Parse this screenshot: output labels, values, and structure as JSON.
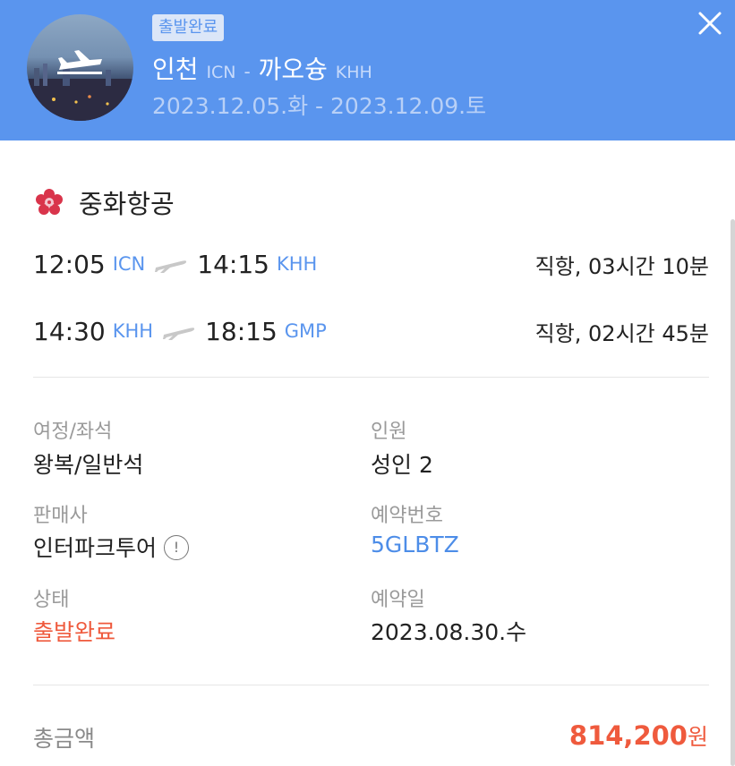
{
  "header": {
    "status_badge": "출발완료",
    "origin_city": "인천",
    "origin_code": "ICN",
    "separator": "-",
    "destination_city": "까오슝",
    "destination_code": "KHH",
    "dates": "2023.12.05.화 - 2023.12.09.토",
    "close_icon": "close-icon",
    "avatar_icon": "airplane-takeoff-icon"
  },
  "airline": {
    "name": "중화항공",
    "logo_icon": "plum-blossom-logo-icon"
  },
  "legs": [
    {
      "depart_time": "12:05",
      "depart_code": "ICN",
      "arrive_time": "14:15",
      "arrive_code": "KHH",
      "duration": "직항, 03시간 10분"
    },
    {
      "depart_time": "14:30",
      "depart_code": "KHH",
      "arrive_time": "18:15",
      "arrive_code": "GMP",
      "duration": "직항, 02시간 45분"
    }
  ],
  "details": {
    "itinerary_label": "여정/좌석",
    "itinerary_value": "왕복/일반석",
    "passengers_label": "인원",
    "passengers_value": "성인 2",
    "seller_label": "판매사",
    "seller_value": "인터파크투어",
    "seller_info_glyph": "!",
    "booking_no_label": "예약번호",
    "booking_no_value": "5GLBTZ",
    "status_label": "상태",
    "status_value": "출발완료",
    "booking_date_label": "예약일",
    "booking_date_value": "2023.08.30.수"
  },
  "total": {
    "label": "총금액",
    "amount": "814,200",
    "unit": "원"
  },
  "colors": {
    "header_bg": "#5a95ee",
    "accent_blue": "#4d8de8",
    "accent_red": "#ef5a3d"
  }
}
